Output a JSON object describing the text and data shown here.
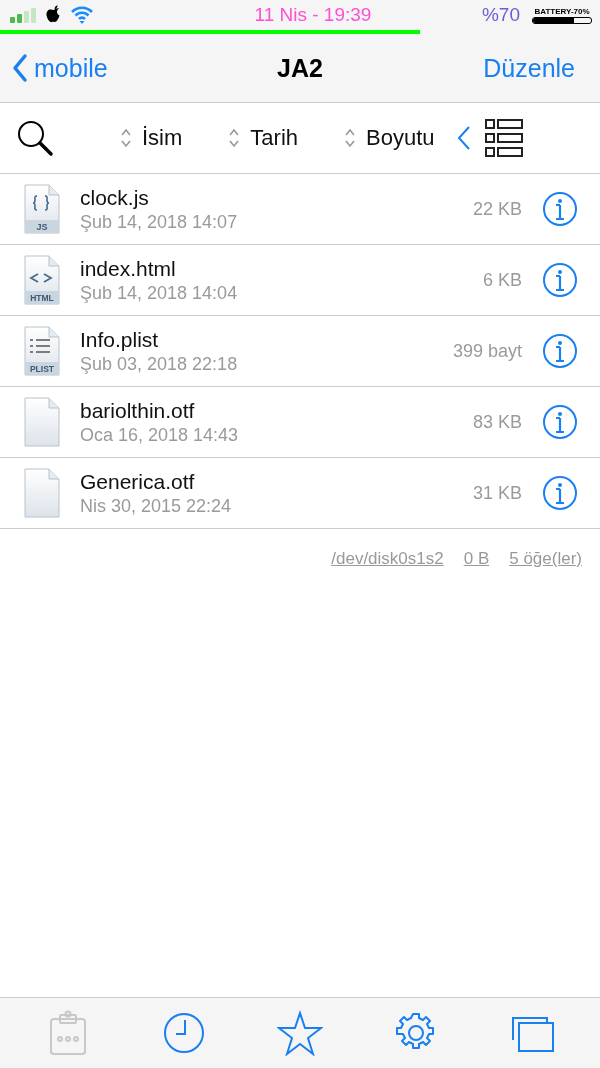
{
  "status_bar": {
    "date_time": "11 Nis - 19:39",
    "battery_percent": "%70",
    "battery_label": "BATTERY-70%",
    "level": 0.7
  },
  "nav": {
    "back": "mobile",
    "title": "JA2",
    "edit": "Düzenle"
  },
  "sort_bar": {
    "columns": [
      "İsim",
      "Tarih",
      "Boyutu"
    ]
  },
  "files": [
    {
      "name": "clock.js",
      "date": "Şub 14, 2018 14:07",
      "size": "22 KB",
      "kind": "code",
      "icon_label": "JS"
    },
    {
      "name": "index.html",
      "date": "Şub 14, 2018 14:04",
      "size": "6 KB",
      "kind": "markup",
      "icon_label": "HTML"
    },
    {
      "name": "Info.plist",
      "date": "Şub 03, 2018 22:18",
      "size": "399 bayt",
      "kind": "list",
      "icon_label": "PLIST"
    },
    {
      "name": "bariolthin.otf",
      "date": "Oca 16, 2018 14:43",
      "size": "83 KB",
      "kind": "blank"
    },
    {
      "name": "Generica.otf",
      "date": "Nis 30, 2015 22:24",
      "size": "31 KB",
      "kind": "blank"
    }
  ],
  "footer": [
    "/dev/disk0s1s2",
    "0 B",
    "5 öğe(ler)"
  ],
  "tab_bar": [
    {
      "kind": "clipboard",
      "disabled": true
    },
    {
      "kind": "clock",
      "disabled": false
    },
    {
      "kind": "star",
      "disabled": false
    },
    {
      "kind": "gear",
      "disabled": false
    },
    {
      "kind": "windows",
      "disabled": false
    }
  ]
}
